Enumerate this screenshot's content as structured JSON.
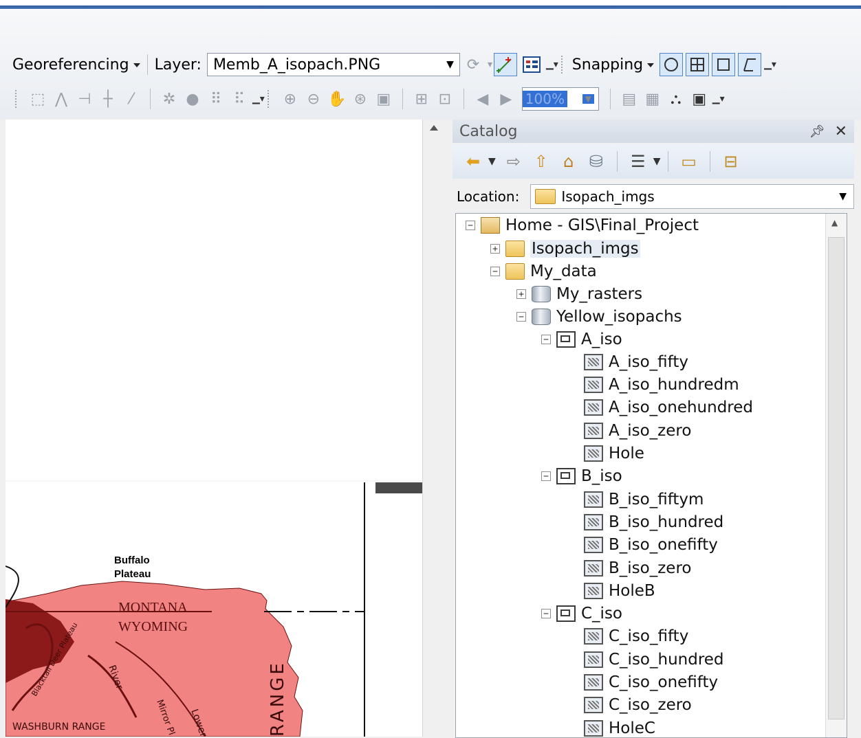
{
  "toolbar_georef": {
    "georeferencing_label": "Georeferencing",
    "layer_label": "Layer:",
    "layer_value": "Memb_A_isopach.PNG",
    "snapping_label": "Snapping",
    "zoom_percent": "100%"
  },
  "catalog": {
    "title": "Catalog",
    "location_label": "Location:",
    "location_value": "Isopach_imgs",
    "tree": [
      {
        "label": "Home - GIS\\Final_Project",
        "icon": "home-folder",
        "expander": "−"
      },
      {
        "label": "Isopach_imgs",
        "icon": "folder",
        "expander": "+"
      },
      {
        "label": "My_data",
        "icon": "folder",
        "expander": "−"
      },
      {
        "label": "My_rasters",
        "icon": "geodatabase",
        "expander": "+"
      },
      {
        "label": "Yellow_isopachs",
        "icon": "geodatabase",
        "expander": "−"
      },
      {
        "label": "A_iso",
        "icon": "feature-dataset",
        "expander": "−"
      },
      {
        "label": "A_iso_fifty",
        "icon": "raster"
      },
      {
        "label": "A_iso_hundredm",
        "icon": "raster"
      },
      {
        "label": "A_iso_onehundred",
        "icon": "raster"
      },
      {
        "label": "A_iso_zero",
        "icon": "raster"
      },
      {
        "label": "Hole",
        "icon": "raster"
      },
      {
        "label": "B_iso",
        "icon": "feature-dataset",
        "expander": "−"
      },
      {
        "label": "B_iso_fiftym",
        "icon": "raster"
      },
      {
        "label": "B_iso_hundred",
        "icon": "raster"
      },
      {
        "label": "B_iso_onefifty",
        "icon": "raster"
      },
      {
        "label": "B_iso_zero",
        "icon": "raster"
      },
      {
        "label": "HoleB",
        "icon": "raster"
      },
      {
        "label": "C_iso",
        "icon": "feature-dataset",
        "expander": "−"
      },
      {
        "label": "C_iso_fifty",
        "icon": "raster"
      },
      {
        "label": "C_iso_hundred",
        "icon": "raster"
      },
      {
        "label": "C_iso_onefifty",
        "icon": "raster"
      },
      {
        "label": "C_iso_zero",
        "icon": "raster"
      },
      {
        "label": "HoleC",
        "icon": "raster"
      }
    ]
  },
  "map": {
    "labels": {
      "buffalo": "Buffalo",
      "plateau": "Plateau",
      "montana": "MONTANA",
      "wyoming": "WYOMING",
      "blacktail": "Blacktail Deer Plateau",
      "river": "River",
      "mirror": "Mirror Pl.",
      "lower": "Lower",
      "washburn": "WASHBURN RANGE",
      "range": "RANGE"
    }
  },
  "colors": {
    "map_fill": "#f28383",
    "map_dark": "#8c1a1a",
    "accent_blue": "#3370d6",
    "title_bar": "#2e5b9e"
  }
}
